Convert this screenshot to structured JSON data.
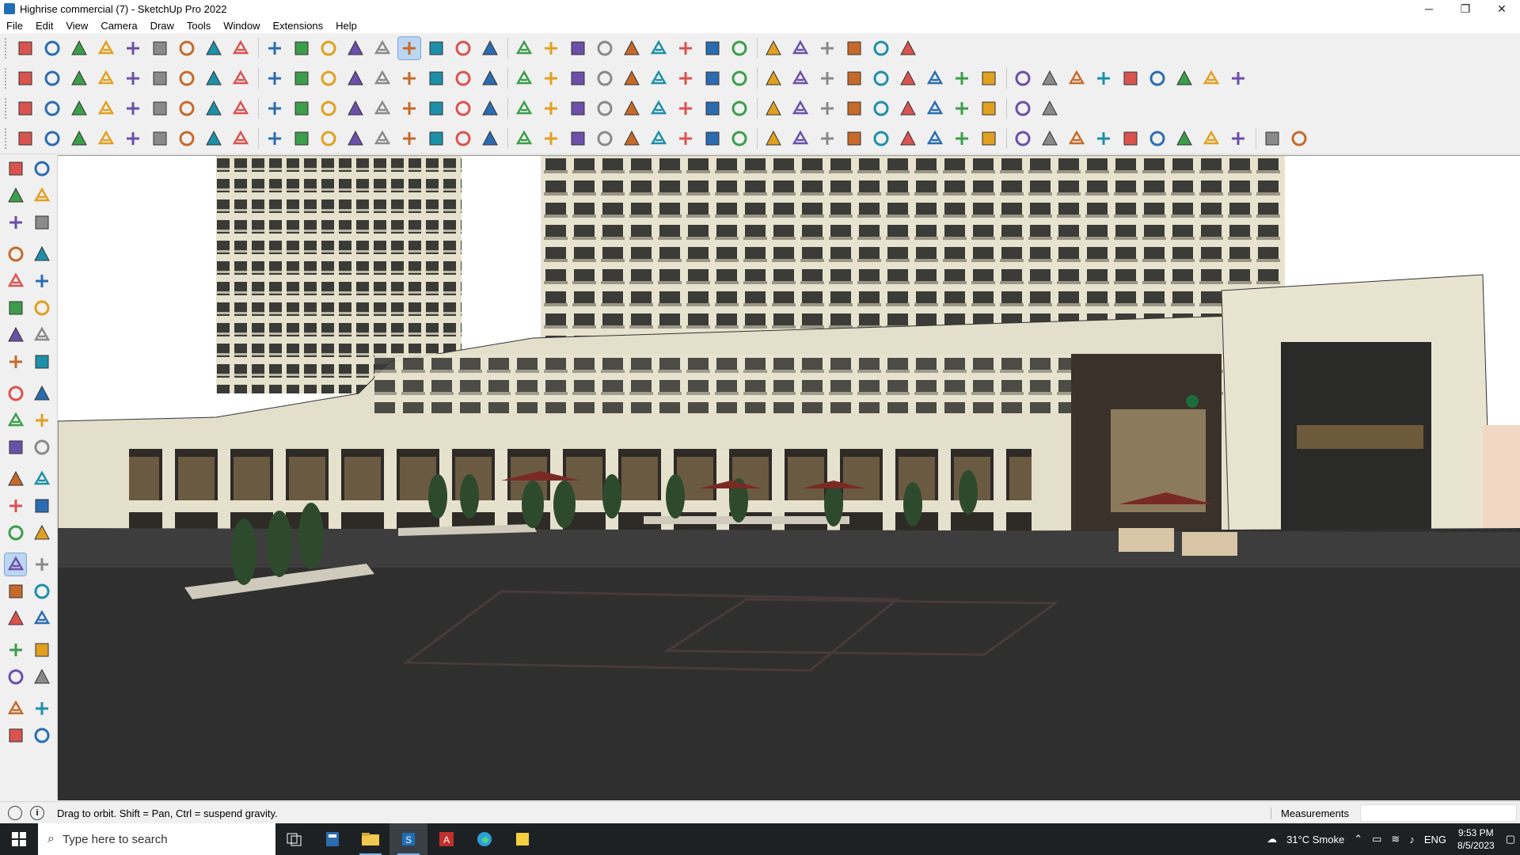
{
  "window": {
    "title": "Highrise commercial (7) - SketchUp Pro 2022",
    "minimize": "─",
    "restore": "❐",
    "close": "✕"
  },
  "menu": [
    "File",
    "Edit",
    "View",
    "Camera",
    "Draw",
    "Tools",
    "Window",
    "Extensions",
    "Help"
  ],
  "status": {
    "hint": "Drag to orbit. Shift = Pan, Ctrl = suspend gravity.",
    "measurements_label": "Measurements",
    "info_icon": "i"
  },
  "taskbar": {
    "search_placeholder": "Type here to search",
    "weather": "31°C  Smoke",
    "language": "ENG",
    "time": "9:53 PM",
    "date": "8/5/2023"
  },
  "icons": {
    "toolbar_row1": [
      "zoom-extents-icon",
      "select-icon",
      "eraser-icon",
      "pencil-icon",
      "arc-icon",
      "rectangle-icon",
      "push-pull-icon",
      "follow-me-icon",
      "move-icon",
      "rotate-icon",
      "scale-icon",
      "tape-measure-icon",
      "text-icon",
      "paint-bucket-icon",
      "orbit-icon",
      "pan-icon",
      "zoom-icon",
      "zoom-window-icon",
      "section-plane-icon",
      "add-location-icon",
      "terrain-icon",
      "sandbox-icon",
      "profile-icon",
      "warehouse-icon",
      "extension-icon",
      "flag-icon",
      "up-arrow-icon",
      "down-arrow-icon",
      "dimension-icon",
      "bounding-box-icon",
      "undo-icon",
      "redo-icon",
      "plugin-icon"
    ],
    "toolbar_row2": [
      "iso-view-icon",
      "top-view-icon",
      "front-view-icon",
      "push-icon",
      "move-down-icon",
      "move-blue-icon",
      "move-red-icon",
      "move-green-icon",
      "move-yellow-icon",
      "move-orange-icon",
      "move-purple-icon",
      "curve-icon",
      "rail-icon",
      "rail2-icon",
      "rail3-icon",
      "green-box-icon",
      "green-move-icon",
      "roof-icon",
      "wall-icon",
      "house-icon",
      "house2-icon",
      "house3-icon",
      "house4-icon",
      "formula-icon",
      "leaf-icon",
      "ruler-icon",
      "shape1-icon",
      "circle-icon",
      "polygon-icon",
      "ellipse-icon",
      "parallelogram-icon",
      "arch-icon",
      "donut-icon",
      "spiral-icon",
      "freehand-icon",
      "outline-icon",
      "pencil-red-icon",
      "highlighter-icon",
      "stamp-icon",
      "grid-icon",
      "solid-union-icon",
      "solid-subtract-icon",
      "solid-trim-icon",
      "solid-split-icon",
      "solid-outer-icon"
    ],
    "toolbar_row3": [
      "layer-blue-icon",
      "layer-cyan-icon",
      "layer-yellow-icon",
      "layer-green-icon",
      "layer-red-icon",
      "layer-white-icon",
      "hook-icon",
      "red-square-icon",
      "list-icon",
      "sheet-icon",
      "box-icon",
      "pipe-icon",
      "curve-path-icon",
      "node-icon",
      "plus-red-icon",
      "plus-green-icon",
      "cross-blue-icon",
      "cone-icon",
      "splash-icon",
      "warning-icon",
      "loop-icon",
      "scissor-icon",
      "rotate-group-icon",
      "snap-icon",
      "bucket-icon",
      "magnet-icon",
      "cube-green-icon",
      "cube-red-icon",
      "cubes-icon",
      "tag-icon",
      "tree-icon",
      "table-icon",
      "window-icon",
      "cross-grid-icon",
      "grid-orange-icon",
      "merge-icon",
      "dots-curve-icon",
      "component-grid-icon"
    ],
    "toolbar_row4": [
      "line-node-icon",
      "spline-icon",
      "car-icon",
      "cut-icon",
      "gear-icon",
      "layers-icon",
      "pipe-bend-icon",
      "mesh-icon",
      "sphere-icon",
      "extrude-icon",
      "corner-icon",
      "corner2-icon",
      "slope-icon",
      "arc-line-icon",
      "frame-icon",
      "triangle-icon",
      "stairs-icon",
      "column-icon",
      "fan-icon",
      "hand-icon",
      "leaf2-icon",
      "arrow-left-icon",
      "roof2-icon",
      "hatch1-icon",
      "hatch2-icon",
      "hatch3-icon",
      "hatch4-icon",
      "hatch5-icon",
      "hatch6-icon",
      "hatch7-icon",
      "hatch8-icon",
      "hatch9-icon",
      "hatch10-icon",
      "hatch11-icon",
      "hatch12-icon",
      "hatch13-icon",
      "hatch14-icon",
      "hatch15-icon",
      "hatch16-icon",
      "hatch17-icon",
      "hatch18-icon",
      "hatch19-icon",
      "hatch20-icon",
      "hatch21-icon",
      "hatch22-icon",
      "hatch23-icon",
      "cube-outline-icon"
    ],
    "left": [
      [
        "select-icon",
        "component-icon"
      ],
      [
        "paint-bucket-icon",
        "eraser-icon"
      ],
      [
        "section-icon",
        "pencil-icon"
      ],
      [
        "line-icon",
        "freehand-icon"
      ],
      [
        "rectangle-icon",
        "rotated-rectangle-icon"
      ],
      [
        "circle-icon",
        "polygon-icon"
      ],
      [
        "arc-icon",
        "two-point-arc-icon"
      ],
      [
        "three-point-arc-icon",
        "pie-icon"
      ],
      [
        "move-icon",
        "push-pull-icon"
      ],
      [
        "rotate-icon",
        "follow-me-icon"
      ],
      [
        "scale-icon",
        "offset-icon"
      ],
      [
        "tape-measure-icon",
        "dimension-icon"
      ],
      [
        "protractor-icon",
        "text-icon"
      ],
      [
        "axes-icon",
        "3d-text-icon"
      ],
      [
        "orbit-icon",
        "pan-icon"
      ],
      [
        "zoom-icon",
        "zoom-window-icon"
      ],
      [
        "zoom-extents-icon",
        "previous-view-icon"
      ],
      [
        "position-camera-icon",
        "look-around-icon"
      ],
      [
        "walk-icon",
        "section-plane-icon"
      ],
      [
        "terrain-icon",
        "sandbox-icon"
      ],
      [
        "warehouse-icon",
        "sandbox2-icon"
      ]
    ]
  },
  "colors": {
    "accent": "#1f6fb4",
    "active_tool": "#bcd6f2",
    "taskbar": "#1e2124",
    "sky": "#ffffff",
    "ground": "#2b2b2b",
    "facade": "#e8e3cf"
  }
}
